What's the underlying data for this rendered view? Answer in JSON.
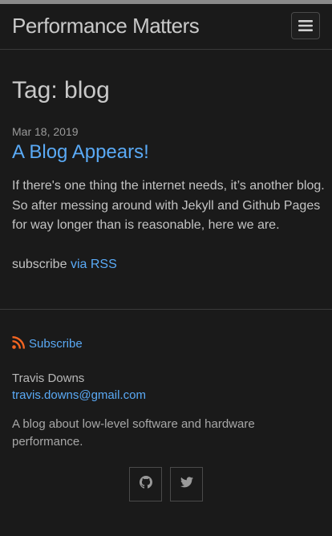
{
  "header": {
    "site_title": "Performance Matters",
    "menu_icon": "hamburger-icon"
  },
  "main": {
    "tag_title": "Tag: blog",
    "post": {
      "date": "Mar 18, 2019",
      "title": "A Blog Appears!",
      "excerpt": "If there's one thing the internet needs, it’s another blog. So after messing around with Jekyll and Github Pages for way longer than is reasonable, here we are."
    },
    "subscribe": {
      "prefix": "subscribe",
      "link_text": "via RSS"
    }
  },
  "footer": {
    "rss_label": "Subscribe",
    "rss_icon": "rss-icon",
    "author_name": "Travis Downs",
    "author_email": "travis.downs@gmail.com",
    "description": "A blog about low-level software and hardware performance.",
    "social": [
      {
        "icon": "github-icon"
      },
      {
        "icon": "twitter-icon"
      }
    ]
  },
  "colors": {
    "background": "#1a1a1a",
    "link": "#5aaaf6",
    "rss": "#f26522"
  }
}
